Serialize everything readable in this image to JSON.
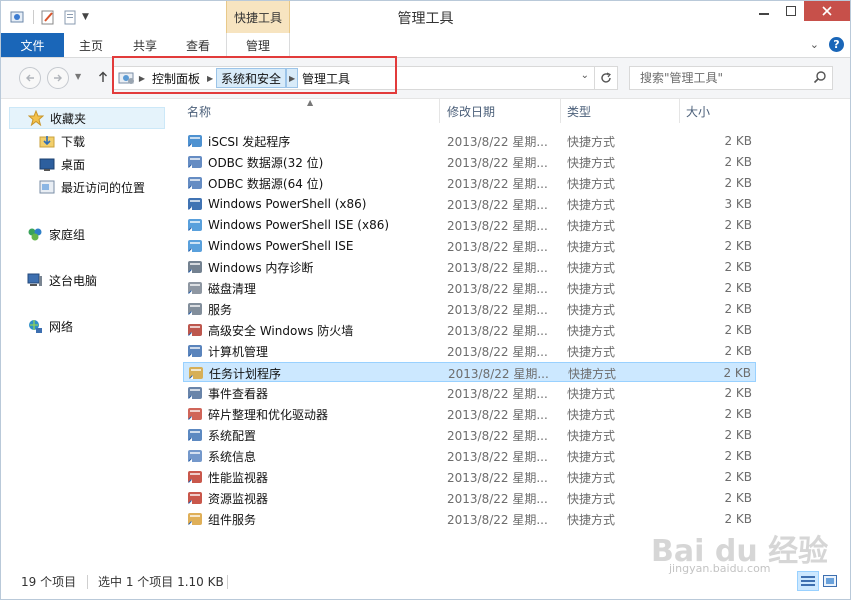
{
  "window": {
    "title": "管理工具",
    "contextual_tab": "快捷工具"
  },
  "ribbon": {
    "tabs": [
      {
        "label": "文件",
        "active": false
      },
      {
        "label": "主页",
        "active": false
      },
      {
        "label": "共享",
        "active": false
      },
      {
        "label": "查看",
        "active": false
      },
      {
        "label": "管理",
        "active": true
      }
    ]
  },
  "address": {
    "crumbs": [
      "控制面板",
      "系统和安全",
      "管理工具"
    ],
    "active_crumb": "系统和安全"
  },
  "search": {
    "placeholder": "搜索\"管理工具\""
  },
  "sidebar": {
    "items": [
      {
        "label": "收藏夹",
        "icon": "star-icon"
      },
      {
        "label": "下载",
        "icon": "download-folder-icon"
      },
      {
        "label": "桌面",
        "icon": "desktop-icon"
      },
      {
        "label": "最近访问的位置",
        "icon": "recent-places-icon"
      },
      {
        "label": "家庭组",
        "icon": "homegroup-icon"
      },
      {
        "label": "这台电脑",
        "icon": "this-pc-icon"
      },
      {
        "label": "网络",
        "icon": "network-icon"
      }
    ]
  },
  "columns": {
    "name": "名称",
    "date": "修改日期",
    "type": "类型",
    "size": "大小"
  },
  "files": [
    {
      "name": "iSCSI 发起程序",
      "date": "2013/8/22 星期...",
      "type": "快捷方式",
      "size": "2 KB",
      "icon": "iscsi-icon"
    },
    {
      "name": "ODBC 数据源(32 位)",
      "date": "2013/8/22 星期...",
      "type": "快捷方式",
      "size": "2 KB",
      "icon": "odbc-icon"
    },
    {
      "name": "ODBC 数据源(64 位)",
      "date": "2013/8/22 星期...",
      "type": "快捷方式",
      "size": "2 KB",
      "icon": "odbc-icon"
    },
    {
      "name": "Windows PowerShell (x86)",
      "date": "2013/8/22 星期...",
      "type": "快捷方式",
      "size": "3 KB",
      "icon": "powershell-icon"
    },
    {
      "name": "Windows PowerShell ISE (x86)",
      "date": "2013/8/22 星期...",
      "type": "快捷方式",
      "size": "2 KB",
      "icon": "powershell-ise-icon"
    },
    {
      "name": "Windows PowerShell ISE",
      "date": "2013/8/22 星期...",
      "type": "快捷方式",
      "size": "2 KB",
      "icon": "powershell-ise-icon"
    },
    {
      "name": "Windows 内存诊断",
      "date": "2013/8/22 星期...",
      "type": "快捷方式",
      "size": "2 KB",
      "icon": "memory-diagnostic-icon"
    },
    {
      "name": "磁盘清理",
      "date": "2013/8/22 星期...",
      "type": "快捷方式",
      "size": "2 KB",
      "icon": "disk-cleanup-icon"
    },
    {
      "name": "服务",
      "date": "2013/8/22 星期...",
      "type": "快捷方式",
      "size": "2 KB",
      "icon": "services-icon"
    },
    {
      "name": "高级安全 Windows 防火墙",
      "date": "2013/8/22 星期...",
      "type": "快捷方式",
      "size": "2 KB",
      "icon": "firewall-icon"
    },
    {
      "name": "计算机管理",
      "date": "2013/8/22 星期...",
      "type": "快捷方式",
      "size": "2 KB",
      "icon": "computer-management-icon"
    },
    {
      "name": "任务计划程序",
      "date": "2013/8/22 星期...",
      "type": "快捷方式",
      "size": "2 KB",
      "icon": "task-scheduler-icon",
      "selected": true
    },
    {
      "name": "事件查看器",
      "date": "2013/8/22 星期...",
      "type": "快捷方式",
      "size": "2 KB",
      "icon": "event-viewer-icon"
    },
    {
      "name": "碎片整理和优化驱动器",
      "date": "2013/8/22 星期...",
      "type": "快捷方式",
      "size": "2 KB",
      "icon": "defrag-icon"
    },
    {
      "name": "系统配置",
      "date": "2013/8/22 星期...",
      "type": "快捷方式",
      "size": "2 KB",
      "icon": "system-config-icon"
    },
    {
      "name": "系统信息",
      "date": "2013/8/22 星期...",
      "type": "快捷方式",
      "size": "2 KB",
      "icon": "system-info-icon"
    },
    {
      "name": "性能监视器",
      "date": "2013/8/22 星期...",
      "type": "快捷方式",
      "size": "2 KB",
      "icon": "performance-monitor-icon"
    },
    {
      "name": "资源监视器",
      "date": "2013/8/22 星期...",
      "type": "快捷方式",
      "size": "2 KB",
      "icon": "resource-monitor-icon"
    },
    {
      "name": "组件服务",
      "date": "2013/8/22 星期...",
      "type": "快捷方式",
      "size": "2 KB",
      "icon": "component-services-icon"
    }
  ],
  "status": {
    "count": "19 个项目",
    "selection": "选中 1 个项目  1.10 KB"
  },
  "watermark": {
    "logo": "Bai du 经验",
    "url": "jingyan.baidu.com"
  },
  "colors": {
    "file_tab": "#1a66b8",
    "contextual": "#f7e4c0",
    "selection": "#cce8ff",
    "highlight": "#e23b3b"
  }
}
